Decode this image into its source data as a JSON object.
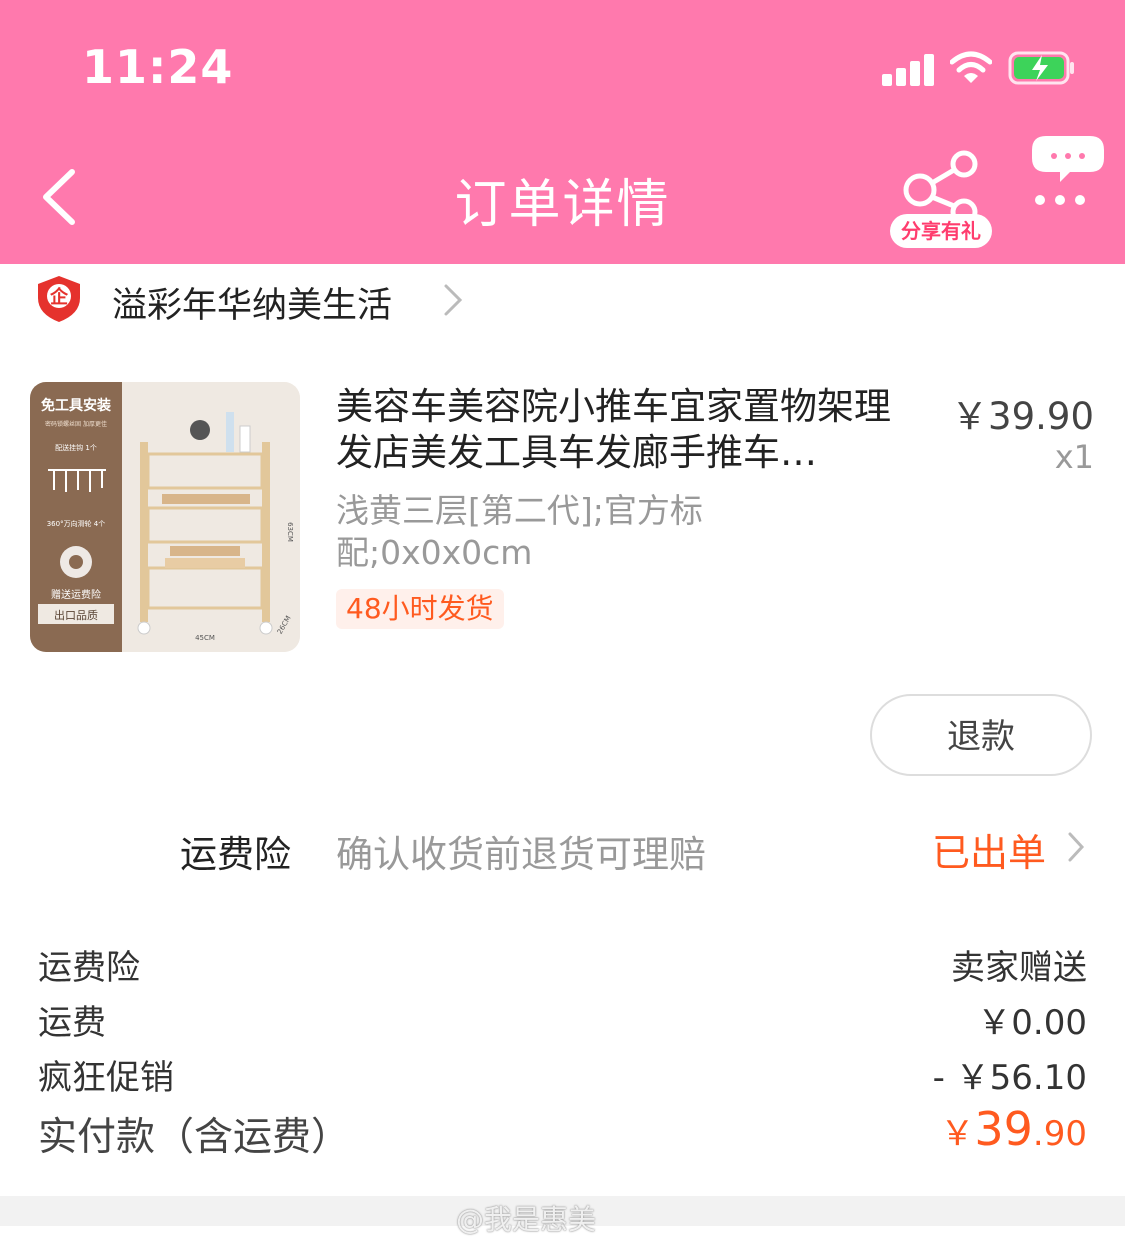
{
  "status_bar": {
    "time": "11:24"
  },
  "header": {
    "title": "订单详情",
    "share_label": "分享有礼"
  },
  "shop": {
    "badge_glyph": "企",
    "name": "溢彩年华纳美生活"
  },
  "product": {
    "title": "美容车美容院小推车宜家置物架理发店美发工具车发廊手推车…",
    "price": "￥39.90",
    "quantity": "x1",
    "spec": "浅黄三层[第二代];官方标配;0x0x0cm",
    "shipping_badge": "48小时发货",
    "image_texts": {
      "top": "免工具安装",
      "sub": "密码锁螺丝固 加厚更佳",
      "hook": "配送挂钩 1个",
      "wheel": "360°万向滑轮 4个",
      "insurance": "赠送运费险",
      "quality": "出口品质",
      "width": "45CM",
      "height": "63CM",
      "depth": "26CM"
    }
  },
  "actions": {
    "refund_label": "退款"
  },
  "insurance_row": {
    "label": "运费险",
    "description": "确认收货前退货可理赔",
    "status": "已出单"
  },
  "summary": {
    "rows": [
      {
        "label": "运费险",
        "value": "卖家赠送"
      },
      {
        "label": "运费",
        "value": "￥0.00"
      },
      {
        "label": "疯狂促销",
        "value": "- ￥56.10"
      }
    ],
    "total_label": "实付款（含运费）",
    "total_currency": "￥",
    "total_integer": "39",
    "total_decimal": ".90"
  },
  "watermark": "@我是惠美",
  "colors": {
    "header_bg": "#ff79ad",
    "accent_orange": "#ff5a1f",
    "muted_text": "#999999"
  }
}
